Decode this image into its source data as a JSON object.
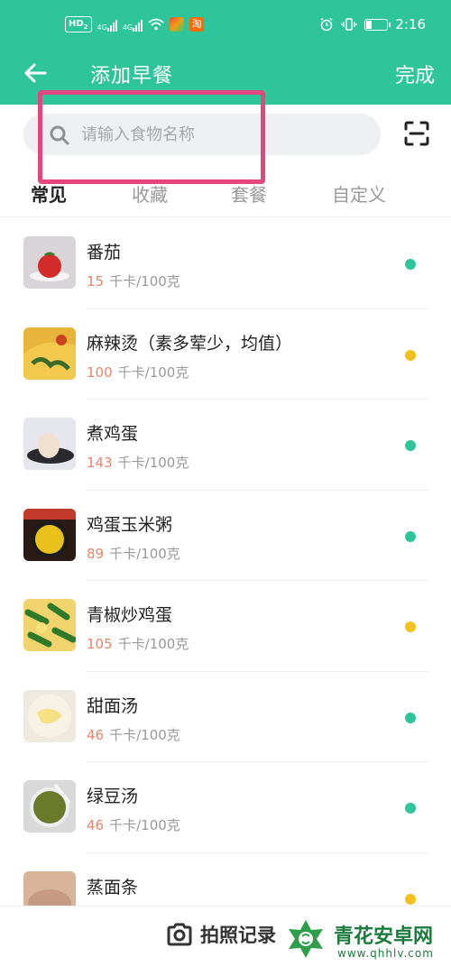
{
  "status_bar": {
    "hd_label": "HD",
    "hd_sub": "2",
    "net1": "4G",
    "net2": "4G",
    "app_badge": "淘",
    "battery_level": 0.3,
    "time": "2:16"
  },
  "header": {
    "title": "添加早餐",
    "done_label": "完成"
  },
  "search": {
    "placeholder": "请输入食物名称",
    "value": ""
  },
  "tabs": [
    {
      "label": "常见",
      "active": true
    },
    {
      "label": "收藏",
      "active": false
    },
    {
      "label": "套餐",
      "active": false
    },
    {
      "label": "自定义",
      "active": false
    }
  ],
  "foods": [
    {
      "name": "番茄",
      "kcal": "15",
      "unit": "千卡/100克",
      "dot": "green",
      "image": "tomato"
    },
    {
      "name": "麻辣烫（素多荤少，均值）",
      "kcal": "100",
      "unit": "千卡/100克",
      "dot": "yellow",
      "image": "malatang"
    },
    {
      "name": "煮鸡蛋",
      "kcal": "143",
      "unit": "千卡/100克",
      "dot": "green",
      "image": "boiled-egg"
    },
    {
      "name": "鸡蛋玉米粥",
      "kcal": "89",
      "unit": "千卡/100克",
      "dot": "green",
      "image": "corn-porridge"
    },
    {
      "name": "青椒炒鸡蛋",
      "kcal": "105",
      "unit": "千卡/100克",
      "dot": "yellow",
      "image": "pepper-egg"
    },
    {
      "name": "甜面汤",
      "kcal": "46",
      "unit": "千卡/100克",
      "dot": "green",
      "image": "sweet-soup"
    },
    {
      "name": "绿豆汤",
      "kcal": "46",
      "unit": "千卡/100克",
      "dot": "green",
      "image": "mung-bean-soup"
    },
    {
      "name": "蒸面条",
      "kcal": "",
      "unit": "",
      "dot": "yellow",
      "image": "steamed-noodles"
    }
  ],
  "bottom": {
    "photo_label": "拍照记录"
  },
  "watermark": {
    "title": "青花安卓网",
    "url": "www.qhhlv.com"
  },
  "colors": {
    "brand": "#2ec59a",
    "highlight": "#e2477d",
    "calorie": "#e7846c",
    "dot_green": "#2ec59a",
    "dot_yellow": "#f2c21b"
  }
}
